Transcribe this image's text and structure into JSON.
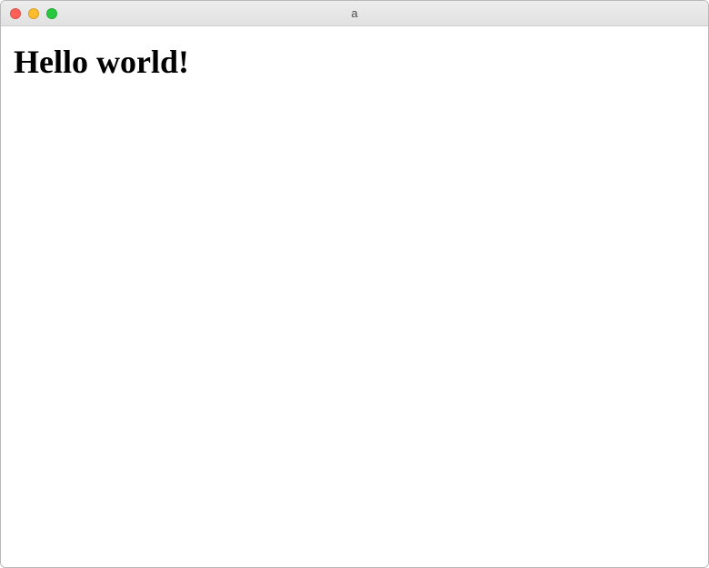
{
  "window": {
    "title": "a"
  },
  "content": {
    "heading": "Hello world!"
  }
}
